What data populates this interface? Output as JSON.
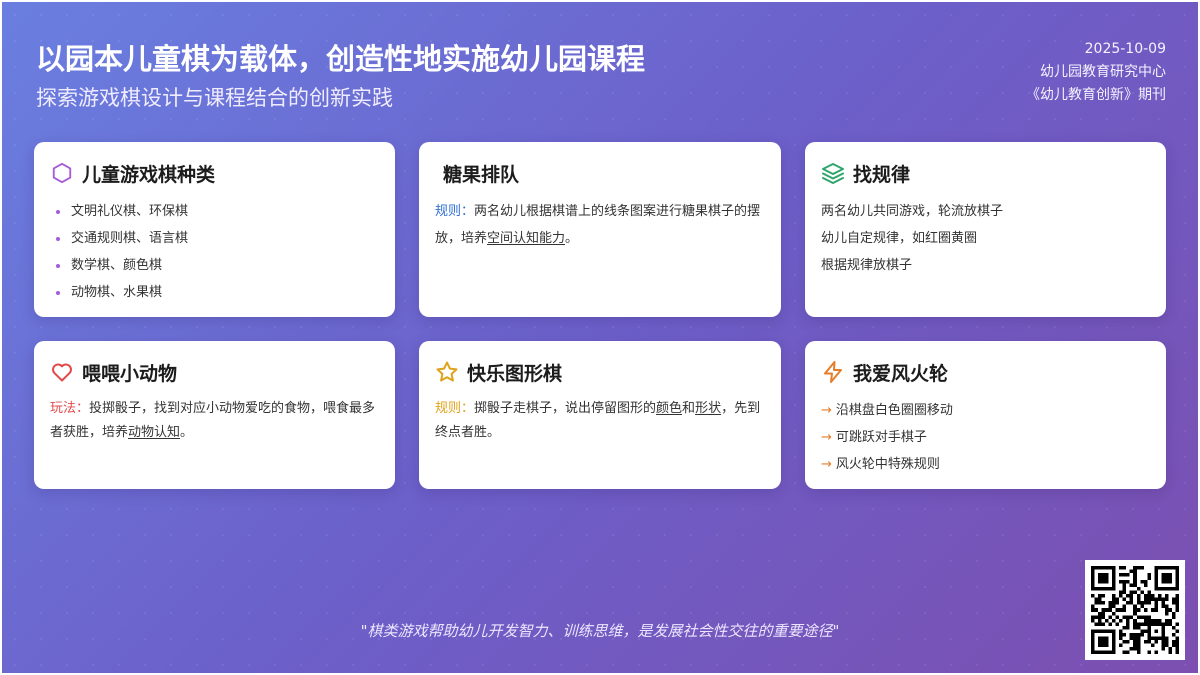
{
  "header": {
    "title": "以园本儿童棋为载体，创造性地实施幼儿园课程",
    "subtitle": "探索游戏棋设计与课程结合的创新实践",
    "date": "2025-10-09",
    "org": "幼儿园教育研究中心",
    "journal": "《幼儿教育创新》期刊"
  },
  "cards": {
    "types": {
      "title": "儿童游戏棋种类",
      "icon": "hexagon-icon",
      "items": [
        "文明礼仪棋、环保棋",
        "交通规则棋、语言棋",
        "数学棋、颜色棋",
        "动物棋、水果棋"
      ]
    },
    "candy": {
      "title": "糖果排队",
      "label": "规则：",
      "text": "两名幼儿根据棋谱上的线条图案进行糖果棋子的摆放，培养",
      "emph": "空间认知能力",
      "end": "。"
    },
    "pattern": {
      "title": "找规律",
      "icon": "layers-icon",
      "lines": [
        "两名幼儿共同游戏，轮流放棋子",
        "幼儿自定规律，如红圈黄圈",
        "根据规律放棋子"
      ]
    },
    "feed": {
      "title": "喂喂小动物",
      "icon": "heart-icon",
      "label": "玩法：",
      "text": "投掷骰子，找到对应小动物爱吃的食物，喂食最多者获胜，培养",
      "emph": "动物认知",
      "end": "。"
    },
    "shape": {
      "title": "快乐图形棋",
      "icon": "star-icon",
      "label": "规则：",
      "text1": "掷骰子走棋子，说出停留图形的",
      "emph1": "颜色",
      "mid": "和",
      "emph2": "形状",
      "text2": "，先到终点者胜。"
    },
    "wheel": {
      "title": "我爱风火轮",
      "icon": "lightning-icon",
      "items": [
        "沿棋盘白色圈圈移动",
        "可跳跃对手棋子",
        "风火轮中特殊规则"
      ]
    }
  },
  "quote": "\"棋类游戏帮助幼儿开发智力、训练思维，是发展社会性交往的重要途径\"",
  "colors": {
    "purple": "#a65bd8",
    "green": "#2fa56b",
    "red": "#e24a4a",
    "yellow": "#e0a21a",
    "orange": "#e57e2a",
    "blue": "#2f6fd8"
  }
}
